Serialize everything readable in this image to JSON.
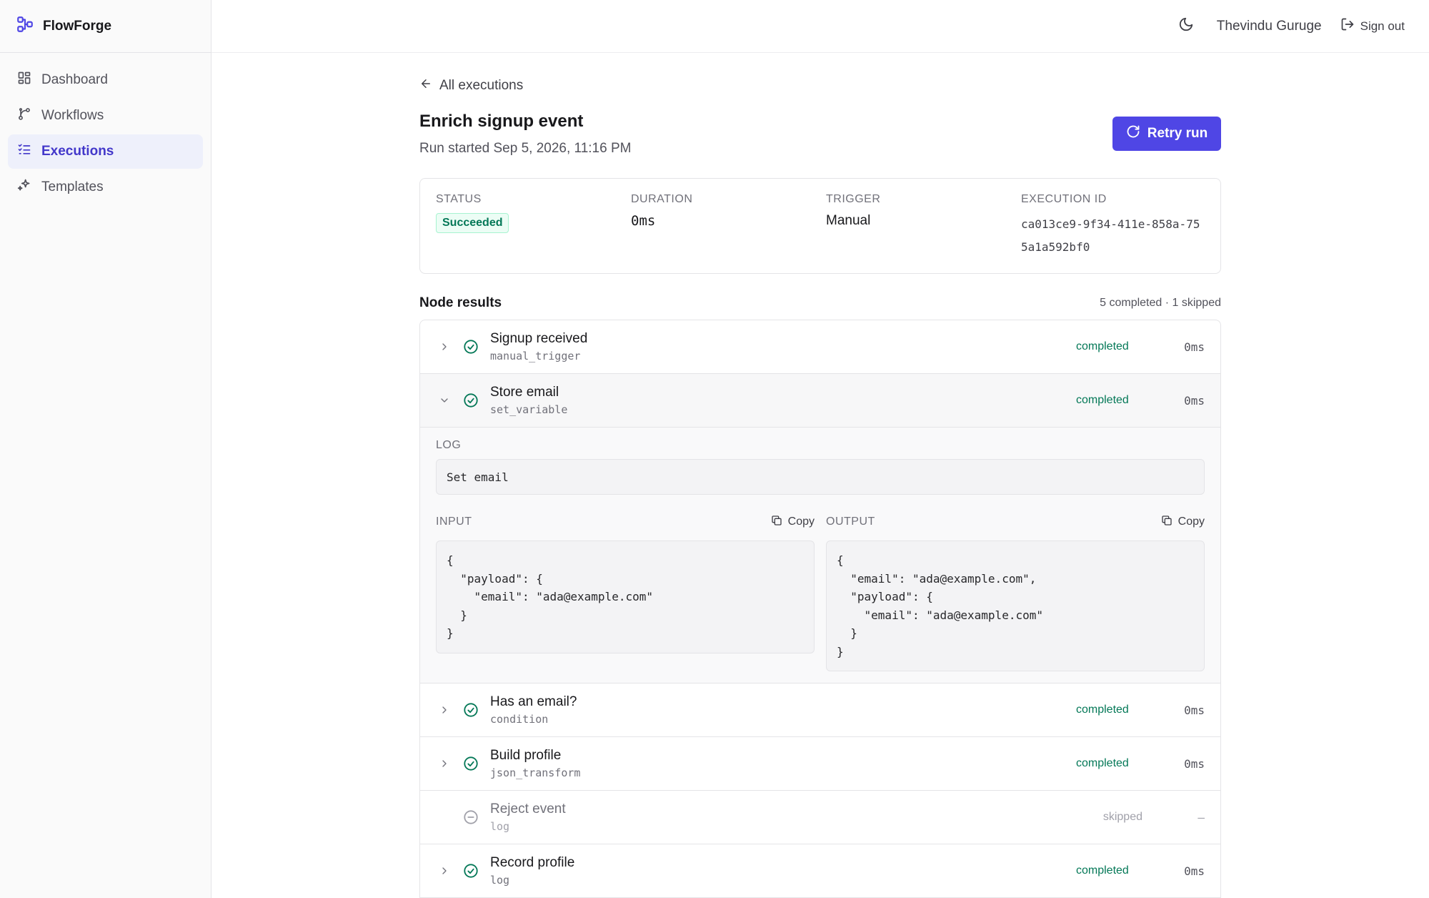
{
  "app": {
    "name": "FlowForge"
  },
  "sidebar": {
    "items": [
      {
        "label": "Dashboard",
        "icon": "dashboard-icon"
      },
      {
        "label": "Workflows",
        "icon": "workflow-icon"
      },
      {
        "label": "Executions",
        "icon": "list-checks-icon",
        "active": true
      },
      {
        "label": "Templates",
        "icon": "sparkles-icon"
      }
    ]
  },
  "topbar": {
    "user_name": "Thevindu Guruge",
    "sign_out_label": "Sign out"
  },
  "page": {
    "back_label": "All executions",
    "title": "Enrich signup event",
    "subtitle": "Run started Sep 5, 2026, 11:16 PM",
    "retry_label": "Retry run"
  },
  "summary": {
    "status_label": "STATUS",
    "status_value": "Succeeded",
    "duration_label": "DURATION",
    "duration_value": "0ms",
    "trigger_label": "TRIGGER",
    "trigger_value": "Manual",
    "execution_id_label": "EXECUTION ID",
    "execution_id_value": "ca013ce9-9f34-411e-858a-755a1a592bf0"
  },
  "nodes_header": {
    "title": "Node results",
    "count": "5 completed · 1 skipped"
  },
  "nodes": [
    {
      "name": "Signup received",
      "type": "manual_trigger",
      "status": "completed",
      "duration": "0ms"
    },
    {
      "name": "Store email",
      "type": "set_variable",
      "status": "completed",
      "duration": "0ms"
    },
    {
      "name": "Has an email?",
      "type": "condition",
      "status": "completed",
      "duration": "0ms"
    },
    {
      "name": "Build profile",
      "type": "json_transform",
      "status": "completed",
      "duration": "0ms"
    },
    {
      "name": "Reject event",
      "type": "log",
      "status": "skipped",
      "duration": "—"
    },
    {
      "name": "Record profile",
      "type": "log",
      "status": "completed",
      "duration": "0ms"
    }
  ],
  "detail": {
    "log_label": "LOG",
    "log_text": "Set email",
    "input_label": "INPUT",
    "output_label": "OUTPUT",
    "copy_label": "Copy",
    "input_json": "{\n  \"payload\": {\n    \"email\": \"ada@example.com\"\n  }\n}",
    "output_json": "{\n  \"email\": \"ada@example.com\",\n  \"payload\": {\n    \"email\": \"ada@example.com\"\n  }\n}"
  },
  "colors": {
    "accent": "#4f46e5",
    "success": "#047857",
    "skipped": "#a1a1aa"
  }
}
